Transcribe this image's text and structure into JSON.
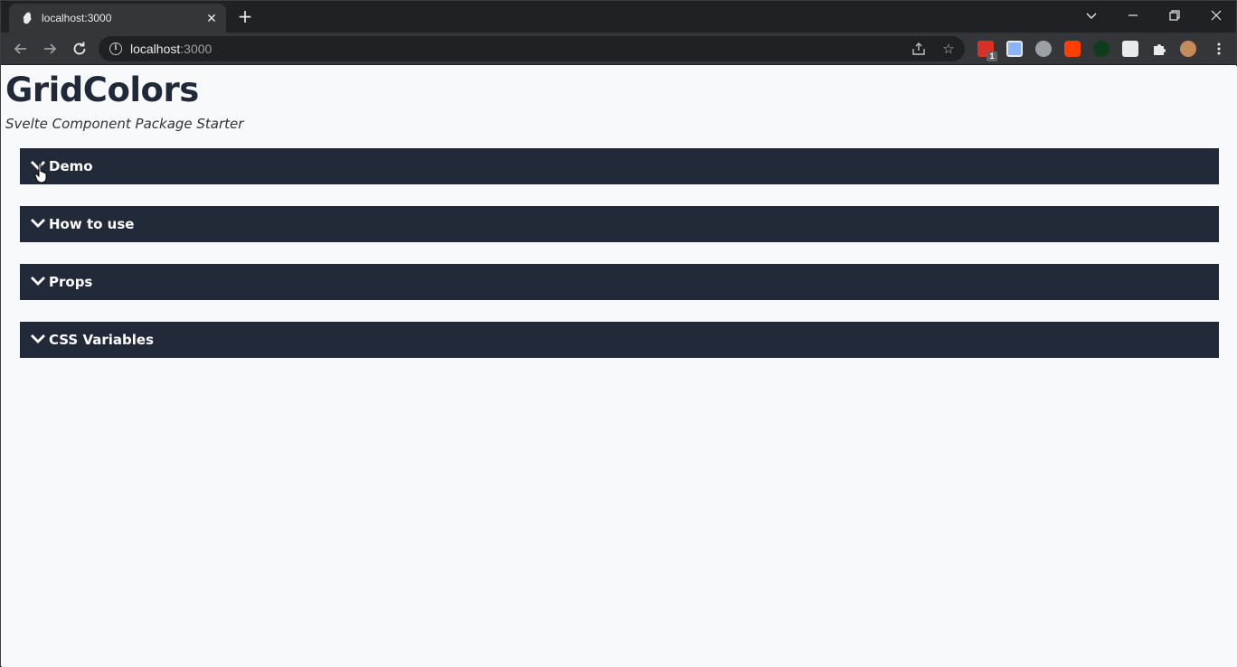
{
  "browser": {
    "tab_title": "localhost:3000",
    "url_host": "localhost",
    "url_port": ":3000",
    "extensions": [
      "extension-red-icon",
      "extension-blue-icon",
      "extension-power-icon",
      "extension-svelte-icon",
      "extension-green-icon",
      "extension-m-icon",
      "extensions-puzzle-icon",
      "profile-avatar-icon"
    ],
    "extension_badge": "1"
  },
  "page": {
    "title": "GridColors",
    "subtitle": "Svelte Component Package Starter",
    "sections": [
      {
        "label": "Demo"
      },
      {
        "label": "How to use"
      },
      {
        "label": "Props"
      },
      {
        "label": "CSS Variables"
      }
    ]
  },
  "colors": {
    "accordion_bg": "#222938",
    "page_bg": "#f8f9fb",
    "title": "#1f2937"
  }
}
